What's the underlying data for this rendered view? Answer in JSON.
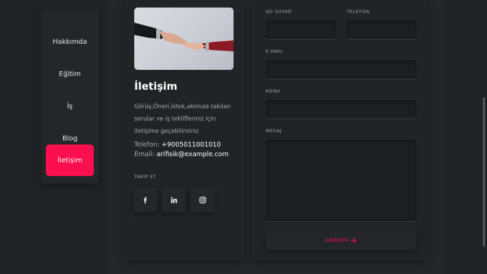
{
  "nav": {
    "items": [
      {
        "label": "Hakkımda"
      },
      {
        "label": "Eğitim"
      },
      {
        "label": "İş"
      },
      {
        "label": "Blog"
      },
      {
        "label": "İletişim",
        "active": true
      }
    ]
  },
  "contact": {
    "title": "İletişim",
    "description": "Görüş,Öneri,İstek,aklınıza takılan sorular ve iş teklifleriniz için iletişime geçebilirsiniz",
    "phone_label": "Telefon: ",
    "phone": "+9005011001010",
    "email_label": "Email: ",
    "email": "arifisik@example.com",
    "follow_label": "TAKİP ET",
    "social_icons": [
      "facebook-icon",
      "linkedin-icon",
      "instagram-icon"
    ]
  },
  "form": {
    "name_label": "AD SOYAD",
    "phone_label": "TELEFON",
    "email_label": "E-MAIL",
    "subject_label": "KONU",
    "message_label": "MESAJ",
    "send_label": "GÖNDER",
    "name_value": "",
    "phone_value": "",
    "email_value": "",
    "subject_value": "",
    "message_value": ""
  },
  "colors": {
    "accent": "#fc0f4f",
    "background": "#212226",
    "panel": "#25262a"
  }
}
